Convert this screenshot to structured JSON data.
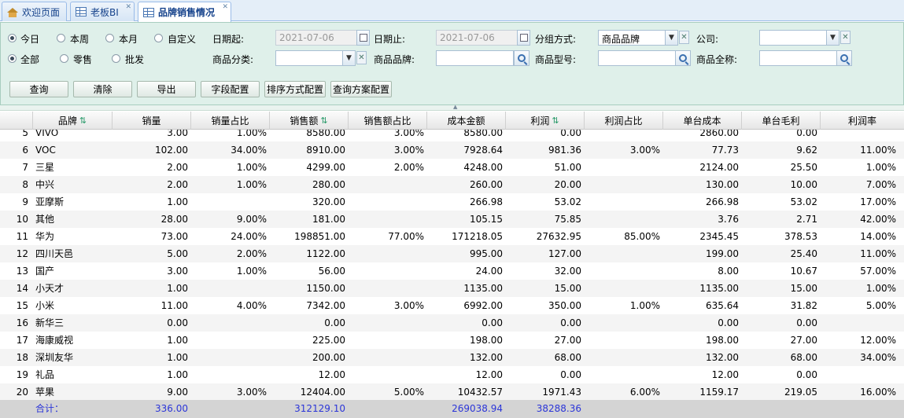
{
  "tabs": [
    {
      "label": "欢迎页面",
      "icon": "home-icon"
    },
    {
      "label": "老板BI",
      "icon": "grid-icon"
    },
    {
      "label": "品牌销售情况",
      "icon": "grid-icon"
    }
  ],
  "filters": {
    "period_options": [
      "今日",
      "本周",
      "本月",
      "自定义"
    ],
    "period_selected": "今日",
    "channel_options": [
      "全部",
      "零售",
      "批发"
    ],
    "channel_selected": "全部",
    "date_from_label": "日期起:",
    "date_from_value": "2021-07-06",
    "date_to_label": "日期止:",
    "date_to_value": "2021-07-06",
    "group_label": "分组方式:",
    "group_value": "商品品牌",
    "company_label": "公司:",
    "company_value": "",
    "category_label": "商品分类:",
    "category_value": "",
    "brand_label": "商品品牌:",
    "brand_value": "",
    "model_label": "商品型号:",
    "model_value": "",
    "fullname_label": "商品全称:",
    "fullname_value": ""
  },
  "buttons": {
    "query": "查询",
    "clear": "清除",
    "export": "导出",
    "field_config": "字段配置",
    "sort_config": "排序方式配置",
    "scheme_config": "查询方案配置"
  },
  "columns": [
    "品牌",
    "销量",
    "销量占比",
    "销售额",
    "销售额占比",
    "成本金额",
    "利润",
    "利润占比",
    "单台成本",
    "单台毛利",
    "利润率"
  ],
  "rows": [
    {
      "n": "5",
      "brand": "VIVO",
      "qty": "3.00",
      "qty_pct": "1.00%",
      "sales": "8580.00",
      "sales_pct": "3.00%",
      "cost": "8580.00",
      "profit": "0.00",
      "profit_pct": "",
      "unit_cost": "2860.00",
      "unit_margin": "0.00",
      "margin_rate": ""
    },
    {
      "n": "6",
      "brand": "VOC",
      "qty": "102.00",
      "qty_pct": "34.00%",
      "sales": "8910.00",
      "sales_pct": "3.00%",
      "cost": "7928.64",
      "profit": "981.36",
      "profit_pct": "3.00%",
      "unit_cost": "77.73",
      "unit_margin": "9.62",
      "margin_rate": "11.00%"
    },
    {
      "n": "7",
      "brand": "三星",
      "qty": "2.00",
      "qty_pct": "1.00%",
      "sales": "4299.00",
      "sales_pct": "2.00%",
      "cost": "4248.00",
      "profit": "51.00",
      "profit_pct": "",
      "unit_cost": "2124.00",
      "unit_margin": "25.50",
      "margin_rate": "1.00%"
    },
    {
      "n": "8",
      "brand": "中兴",
      "qty": "2.00",
      "qty_pct": "1.00%",
      "sales": "280.00",
      "sales_pct": "",
      "cost": "260.00",
      "profit": "20.00",
      "profit_pct": "",
      "unit_cost": "130.00",
      "unit_margin": "10.00",
      "margin_rate": "7.00%"
    },
    {
      "n": "9",
      "brand": "亚摩斯",
      "qty": "1.00",
      "qty_pct": "",
      "sales": "320.00",
      "sales_pct": "",
      "cost": "266.98",
      "profit": "53.02",
      "profit_pct": "",
      "unit_cost": "266.98",
      "unit_margin": "53.02",
      "margin_rate": "17.00%"
    },
    {
      "n": "10",
      "brand": "其他",
      "qty": "28.00",
      "qty_pct": "9.00%",
      "sales": "181.00",
      "sales_pct": "",
      "cost": "105.15",
      "profit": "75.85",
      "profit_pct": "",
      "unit_cost": "3.76",
      "unit_margin": "2.71",
      "margin_rate": "42.00%"
    },
    {
      "n": "11",
      "brand": "华为",
      "qty": "73.00",
      "qty_pct": "24.00%",
      "sales": "198851.00",
      "sales_pct": "77.00%",
      "cost": "171218.05",
      "profit": "27632.95",
      "profit_pct": "85.00%",
      "unit_cost": "2345.45",
      "unit_margin": "378.53",
      "margin_rate": "14.00%"
    },
    {
      "n": "12",
      "brand": "四川天邑",
      "qty": "5.00",
      "qty_pct": "2.00%",
      "sales": "1122.00",
      "sales_pct": "",
      "cost": "995.00",
      "profit": "127.00",
      "profit_pct": "",
      "unit_cost": "199.00",
      "unit_margin": "25.40",
      "margin_rate": "11.00%"
    },
    {
      "n": "13",
      "brand": "国产",
      "qty": "3.00",
      "qty_pct": "1.00%",
      "sales": "56.00",
      "sales_pct": "",
      "cost": "24.00",
      "profit": "32.00",
      "profit_pct": "",
      "unit_cost": "8.00",
      "unit_margin": "10.67",
      "margin_rate": "57.00%"
    },
    {
      "n": "14",
      "brand": "小天才",
      "qty": "1.00",
      "qty_pct": "",
      "sales": "1150.00",
      "sales_pct": "",
      "cost": "1135.00",
      "profit": "15.00",
      "profit_pct": "",
      "unit_cost": "1135.00",
      "unit_margin": "15.00",
      "margin_rate": "1.00%"
    },
    {
      "n": "15",
      "brand": "小米",
      "qty": "11.00",
      "qty_pct": "4.00%",
      "sales": "7342.00",
      "sales_pct": "3.00%",
      "cost": "6992.00",
      "profit": "350.00",
      "profit_pct": "1.00%",
      "unit_cost": "635.64",
      "unit_margin": "31.82",
      "margin_rate": "5.00%"
    },
    {
      "n": "16",
      "brand": "新华三",
      "qty": "0.00",
      "qty_pct": "",
      "sales": "0.00",
      "sales_pct": "",
      "cost": "0.00",
      "profit": "0.00",
      "profit_pct": "",
      "unit_cost": "0.00",
      "unit_margin": "0.00",
      "margin_rate": ""
    },
    {
      "n": "17",
      "brand": "海康威视",
      "qty": "1.00",
      "qty_pct": "",
      "sales": "225.00",
      "sales_pct": "",
      "cost": "198.00",
      "profit": "27.00",
      "profit_pct": "",
      "unit_cost": "198.00",
      "unit_margin": "27.00",
      "margin_rate": "12.00%"
    },
    {
      "n": "18",
      "brand": "深圳友华",
      "qty": "1.00",
      "qty_pct": "",
      "sales": "200.00",
      "sales_pct": "",
      "cost": "132.00",
      "profit": "68.00",
      "profit_pct": "",
      "unit_cost": "132.00",
      "unit_margin": "68.00",
      "margin_rate": "34.00%"
    },
    {
      "n": "19",
      "brand": "礼品",
      "qty": "1.00",
      "qty_pct": "",
      "sales": "12.00",
      "sales_pct": "",
      "cost": "12.00",
      "profit": "0.00",
      "profit_pct": "",
      "unit_cost": "12.00",
      "unit_margin": "0.00",
      "margin_rate": ""
    },
    {
      "n": "20",
      "brand": "苹果",
      "qty": "9.00",
      "qty_pct": "3.00%",
      "sales": "12404.00",
      "sales_pct": "5.00%",
      "cost": "10432.57",
      "profit": "1971.43",
      "profit_pct": "6.00%",
      "unit_cost": "1159.17",
      "unit_margin": "219.05",
      "margin_rate": "16.00%"
    }
  ],
  "totals": {
    "label": "合计：",
    "qty": "336.00",
    "sales": "312129.10",
    "cost": "269038.94",
    "profit": "38288.36"
  },
  "colors": {
    "panel_bg": "#dff0ea",
    "total_text": "#2b35d8",
    "sort_arrow": "#2a9a6a"
  }
}
